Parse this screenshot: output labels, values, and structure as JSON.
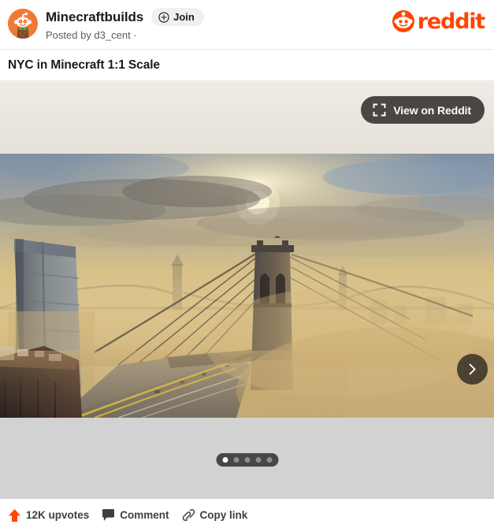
{
  "header": {
    "avatar_icon": "snoo-minecraft-avatar",
    "subreddit": "Minecraftbuilds",
    "join_label": "Join",
    "join_icon": "plus-circle-icon",
    "posted_by": "Posted by d3_cent ·",
    "brand_icon": "reddit-snoo-logo-icon",
    "brand_word": "reddit",
    "brand_color": "#ff4500"
  },
  "post": {
    "title": "NYC in Minecraft 1:1 Scale"
  },
  "media": {
    "view_button_label": "View on Reddit",
    "view_button_icon": "expand-fullscreen-icon",
    "next_icon": "chevron-right-icon",
    "dot_count": 5,
    "active_dot": 0,
    "scene_description": "Aerial Minecraft render of the Brooklyn Bridge and NYC skyline in golden sunset fog"
  },
  "actions": [
    {
      "icon": "upvote-arrow-icon",
      "label": "12K upvotes",
      "color": "#ff4500"
    },
    {
      "icon": "comment-bubble-icon",
      "label": "Comment",
      "color": "#3d4042"
    },
    {
      "icon": "link-chain-icon",
      "label": "Copy link",
      "color": "#3d4042"
    }
  ]
}
